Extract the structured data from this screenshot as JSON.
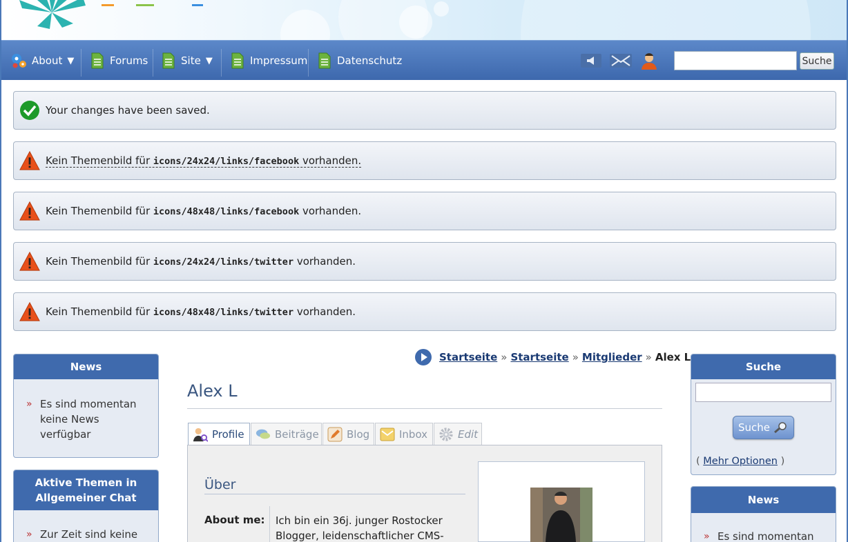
{
  "nav": {
    "items": [
      {
        "label": "About",
        "has_caret": true
      },
      {
        "label": "Forums",
        "has_caret": false
      },
      {
        "label": "Site",
        "has_caret": true
      },
      {
        "label": "Impressum",
        "has_caret": false
      },
      {
        "label": "Datenschutz",
        "has_caret": false
      }
    ],
    "caret": "▼",
    "search_button": "Suche"
  },
  "messages": {
    "saved": "Your changes have been saved.",
    "prefix": "Kein Themenbild für ",
    "suffix": " vorhanden.",
    "paths": [
      "icons/24x24/links/facebook",
      "icons/48x48/links/facebook",
      "icons/24x24/links/twitter",
      "icons/48x48/links/twitter"
    ]
  },
  "left": {
    "news_title": "News",
    "news_item": "Es sind momentan keine News verfügbar",
    "active_title": "Aktive Themen in Allgemeiner Chat",
    "active_item": "Zur Zeit sind keine",
    "bullet": "»"
  },
  "breadcrumb": {
    "links": [
      "Startseite",
      "Startseite",
      "Mitglieder"
    ],
    "current": "Alex L",
    "sep": "»"
  },
  "profile": {
    "name": "Alex L",
    "tabs": [
      "Profile",
      "Beiträge",
      "Blog",
      "Inbox",
      "Edit"
    ],
    "section_title": "Über",
    "about_label": "About me:",
    "about_text": "Ich bin ein 36j. junger Rostocker Blogger, leidenschaftlicher CMS-"
  },
  "right": {
    "search_title": "Suche",
    "search_button": "Suche",
    "more_options": "Mehr Optionen",
    "paren_open": "(",
    "paren_close": ")",
    "news_title": "News",
    "news_item": "Es sind momentan"
  },
  "colors": {
    "nav": "#3d68ad",
    "box_head": "#3f6aad",
    "link": "#1a3a73",
    "success": "#1e9a2a",
    "warning": "#e8501a"
  }
}
